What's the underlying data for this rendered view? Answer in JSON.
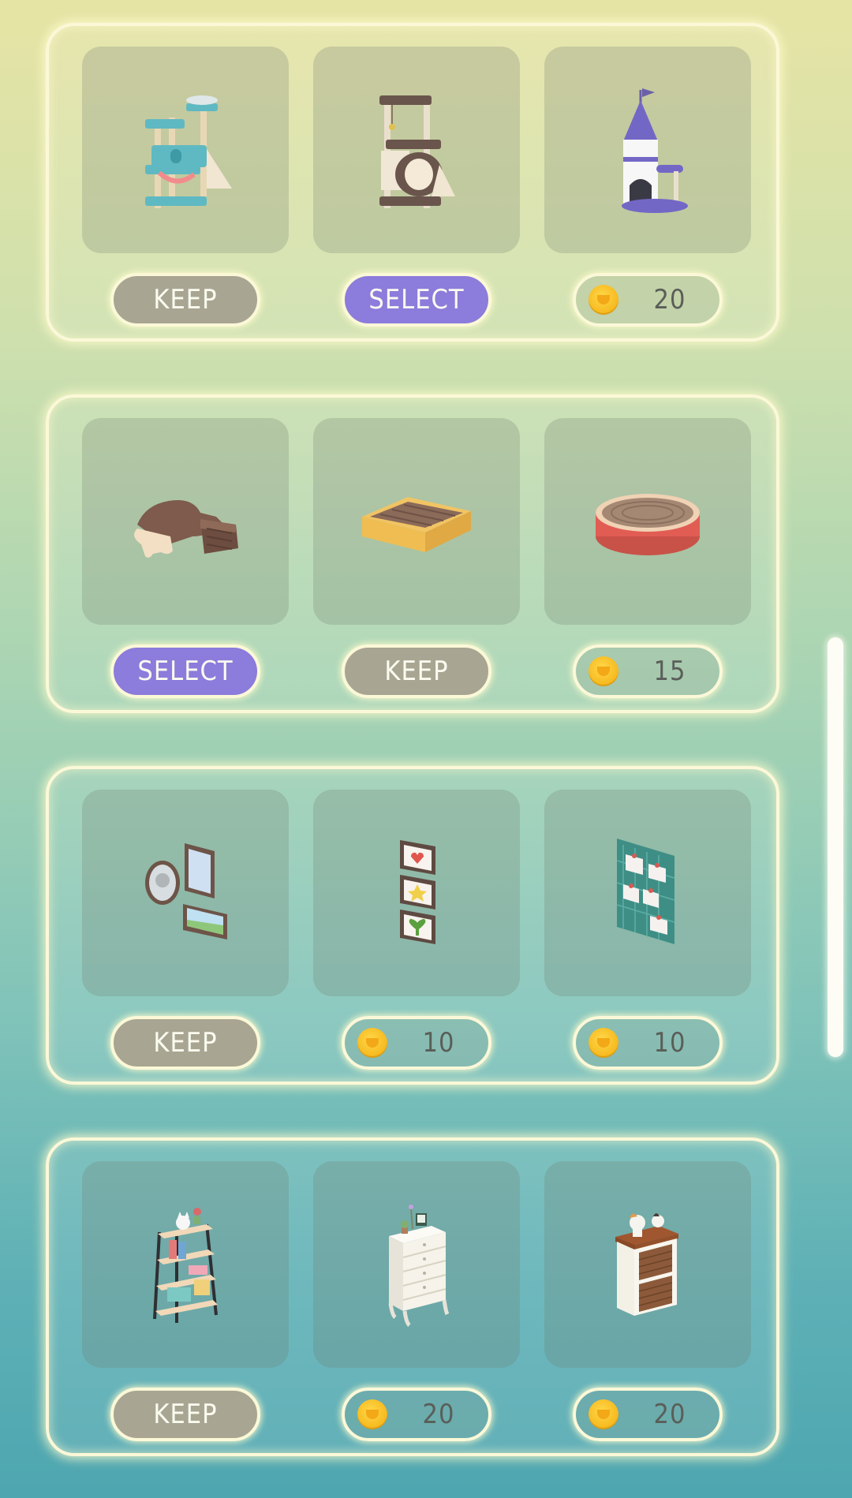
{
  "shop": {
    "rows": [
      {
        "items": [
          {
            "name": "teal-cat-tower",
            "button": {
              "kind": "keep",
              "label": "KEEP"
            }
          },
          {
            "name": "brown-cat-tower",
            "button": {
              "kind": "select",
              "label": "SELECT"
            }
          },
          {
            "name": "castle-cat-tower",
            "button": {
              "kind": "price",
              "price": "20"
            }
          }
        ]
      },
      {
        "items": [
          {
            "name": "cat-shaped-scratcher",
            "button": {
              "kind": "select",
              "label": "SELECT"
            }
          },
          {
            "name": "box-scratcher-bed",
            "button": {
              "kind": "keep",
              "label": "KEEP"
            }
          },
          {
            "name": "round-red-scratcher",
            "button": {
              "kind": "price",
              "price": "15"
            }
          }
        ]
      },
      {
        "items": [
          {
            "name": "wall-frames-set",
            "button": {
              "kind": "keep",
              "label": "KEEP"
            }
          },
          {
            "name": "vertical-frames",
            "button": {
              "kind": "price",
              "price": "10"
            }
          },
          {
            "name": "memo-board",
            "button": {
              "kind": "price",
              "price": "10"
            }
          }
        ]
      },
      {
        "items": [
          {
            "name": "metal-shelf",
            "button": {
              "kind": "keep",
              "label": "KEEP"
            }
          },
          {
            "name": "white-dresser",
            "button": {
              "kind": "price",
              "price": "20"
            }
          },
          {
            "name": "basket-cabinet",
            "button": {
              "kind": "price",
              "price": "20"
            }
          }
        ]
      }
    ]
  },
  "colors": {
    "keep_button": "#a8a692",
    "select_button": "#8c7cdb",
    "panel_border": "#fbf8d8",
    "coin": "#f6b81d"
  },
  "icons": {
    "coin": "coin-icon"
  }
}
